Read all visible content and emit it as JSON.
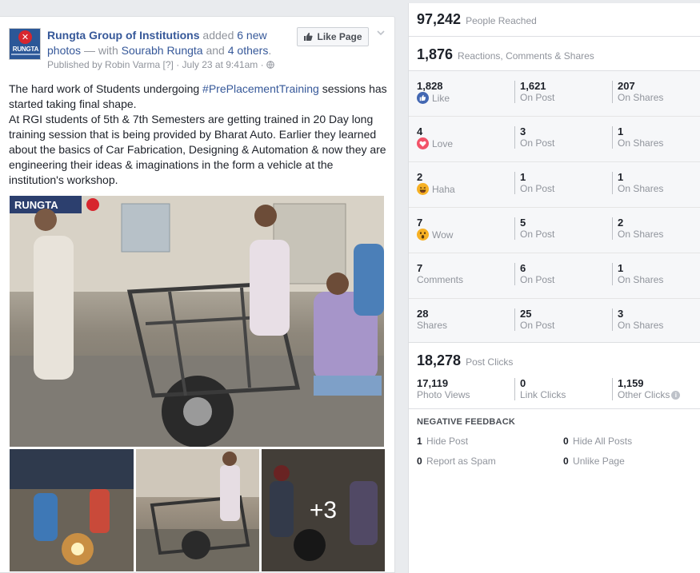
{
  "post": {
    "page_name": "Rungta Group of Institutions",
    "avatar_text": "RUNGTA",
    "added_text": "added",
    "photos_count_link": "6 new photos",
    "with_text": "— with",
    "tagged_person": "Sourabh Rungta",
    "and_text": "and",
    "others_link": "4 others",
    "period": ".",
    "published_by": "Published by Robin Varma",
    "help_mark": "[?]",
    "date": "· July 23 at 9:41am ·",
    "like_page_label": "Like Page",
    "text_line1_pre": "The hard work of Students undergoing ",
    "hashtag": "#PrePlacementTraining",
    "text_line1_post": " sessions has started taking final shape.",
    "text_paragraph2": "At RGI students of 5th & 7th Semesters are getting trained in 20 Day long training session that is being provided by Bharat Auto. Earlier they learned about the basics of Car Fabrication, Designing & Automation & now they are engineering their ideas & imaginations in the form a vehicle at the institution's workshop.",
    "more_photos_overlay": "+3",
    "photo_watermark": "RUNGTA"
  },
  "insights": {
    "people_reached": {
      "value": "97,242",
      "label": "People Reached"
    },
    "engagement": {
      "value": "1,876",
      "label": "Reactions, Comments & Shares"
    },
    "reactions": [
      {
        "total": "1,828",
        "label": "Like",
        "icon": "like-icon",
        "on_post": "1,621",
        "on_post_label": "On Post",
        "on_shares": "207",
        "on_shares_label": "On Shares"
      },
      {
        "total": "4",
        "label": "Love",
        "icon": "love-icon",
        "on_post": "3",
        "on_post_label": "On Post",
        "on_shares": "1",
        "on_shares_label": "On Shares"
      },
      {
        "total": "2",
        "label": "Haha",
        "icon": "haha-icon",
        "on_post": "1",
        "on_post_label": "On Post",
        "on_shares": "1",
        "on_shares_label": "On Shares"
      },
      {
        "total": "7",
        "label": "Wow",
        "icon": "wow-icon",
        "on_post": "5",
        "on_post_label": "On Post",
        "on_shares": "2",
        "on_shares_label": "On Shares"
      },
      {
        "total": "7",
        "label": "Comments",
        "icon": "",
        "on_post": "6",
        "on_post_label": "On Post",
        "on_shares": "1",
        "on_shares_label": "On Shares"
      },
      {
        "total": "28",
        "label": "Shares",
        "icon": "",
        "on_post": "25",
        "on_post_label": "On Post",
        "on_shares": "3",
        "on_shares_label": "On Shares"
      }
    ],
    "post_clicks": {
      "value": "18,278",
      "label": "Post Clicks"
    },
    "clicks": [
      {
        "value": "17,119",
        "label": "Photo Views"
      },
      {
        "value": "0",
        "label": "Link Clicks"
      },
      {
        "value": "1,159",
        "label": "Other Clicks",
        "info_icon": "i"
      }
    ],
    "negative_feedback_title": "NEGATIVE FEEDBACK",
    "negative_feedback": [
      {
        "value": "1",
        "label": "Hide Post"
      },
      {
        "value": "0",
        "label": "Hide All Posts"
      },
      {
        "value": "0",
        "label": "Report as Spam"
      },
      {
        "value": "0",
        "label": "Unlike Page"
      }
    ]
  },
  "colors": {
    "link": "#365899",
    "text": "#1d2129",
    "muted": "#90949c",
    "like_blue": "#4267b2",
    "love_red": "#f25268",
    "haha_yellow": "#f7b125"
  }
}
